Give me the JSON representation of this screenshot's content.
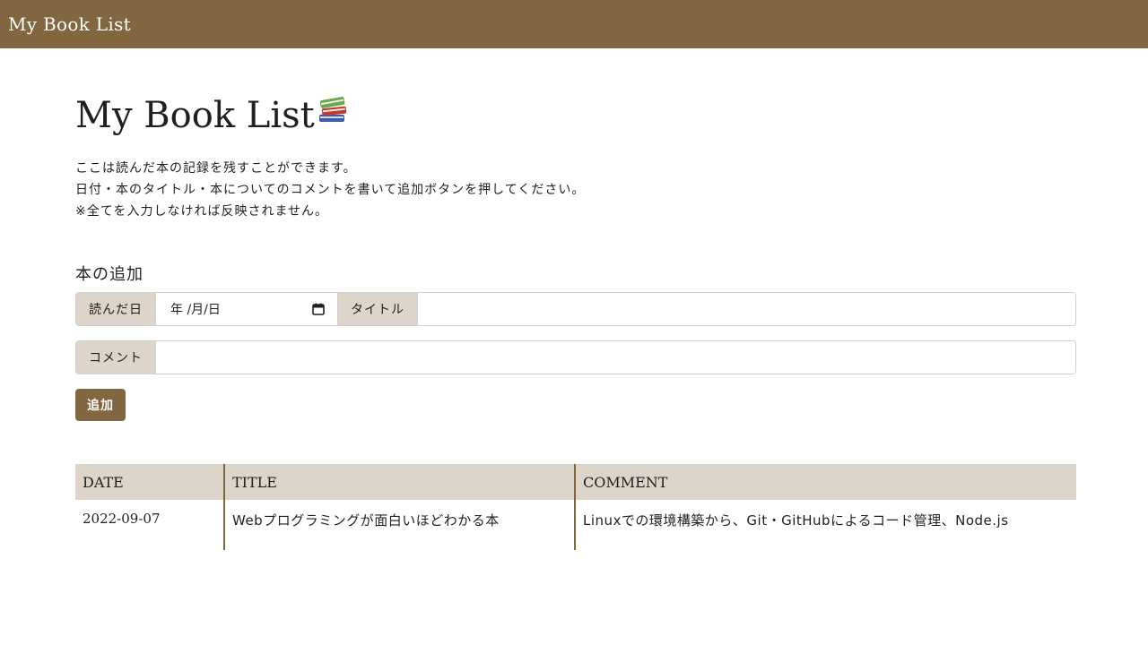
{
  "navbar": {
    "brand": "My Book List"
  },
  "page": {
    "title": "My Book List",
    "title_icon": "books-icon",
    "intro": [
      "ここは読んだ本の記録を残すことができます。",
      "日付・本のタイトル・本についてのコメントを書いて追加ボタンを押してください。",
      "※全てを入力しなければ反映されません。"
    ]
  },
  "form": {
    "section_title": "本の追加",
    "date_label": "読んだ日",
    "date_placeholder": "年 /月/日",
    "title_label": "タイトル",
    "title_value": "",
    "comment_label": "コメント",
    "comment_value": "",
    "submit_label": "追加"
  },
  "table": {
    "headers": [
      "DATE",
      "TITLE",
      "COMMENT"
    ],
    "rows": [
      {
        "date": "2022-09-07",
        "title": "Webプログラミングが面白いほどわかる本",
        "comment": "Linuxでの環境構築から、Git・GitHubによるコード管理、Node.js"
      }
    ]
  },
  "colors": {
    "accent": "#82663f",
    "addon_bg": "#ddd5c9",
    "text": "#1f1f1f"
  }
}
